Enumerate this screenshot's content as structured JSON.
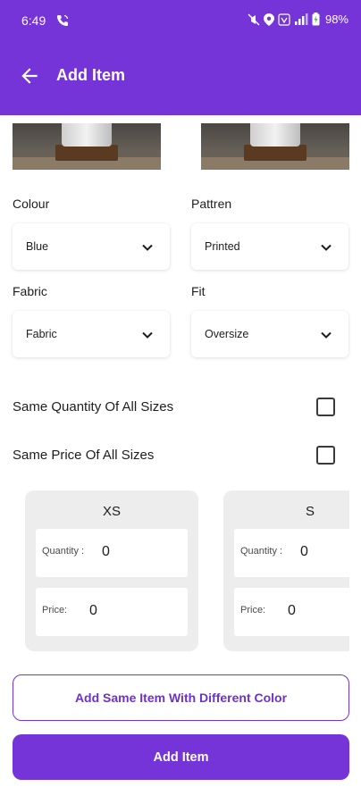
{
  "status_bar": {
    "time": "6:49",
    "battery": "98%",
    "icons": [
      "wifi-call-icon",
      "mute-icon",
      "location-icon",
      "vowifi-icon",
      "signal-icon",
      "battery-icon"
    ]
  },
  "app_bar": {
    "title": "Add Item",
    "back_icon": "arrow-back-icon"
  },
  "form": {
    "colour": {
      "label": "Colour",
      "value": "Blue"
    },
    "pattern": {
      "label": "Pattren",
      "value": "Printed"
    },
    "fabric": {
      "label": "Fabric",
      "value": "Fabric"
    },
    "fit": {
      "label": "Fit",
      "value": "Oversize"
    }
  },
  "options": {
    "same_quantity": {
      "label": "Same Quantity Of All Sizes",
      "checked": false
    },
    "same_price": {
      "label": "Same Price Of All Sizes",
      "checked": false
    }
  },
  "sizes": [
    {
      "size": "XS",
      "quantity_label": "Quantity :",
      "quantity": "0",
      "price_label": "Price:",
      "price": "0"
    },
    {
      "size": "S",
      "quantity_label": "Quantity :",
      "quantity": "0",
      "price_label": "Price:",
      "price": "0"
    }
  ],
  "actions": {
    "add_same_item_label": "Add Same Item With Different Color",
    "add_item_label": "Add Item"
  },
  "colors": {
    "primary": "#7434d8",
    "card_bg": "#ededed"
  }
}
